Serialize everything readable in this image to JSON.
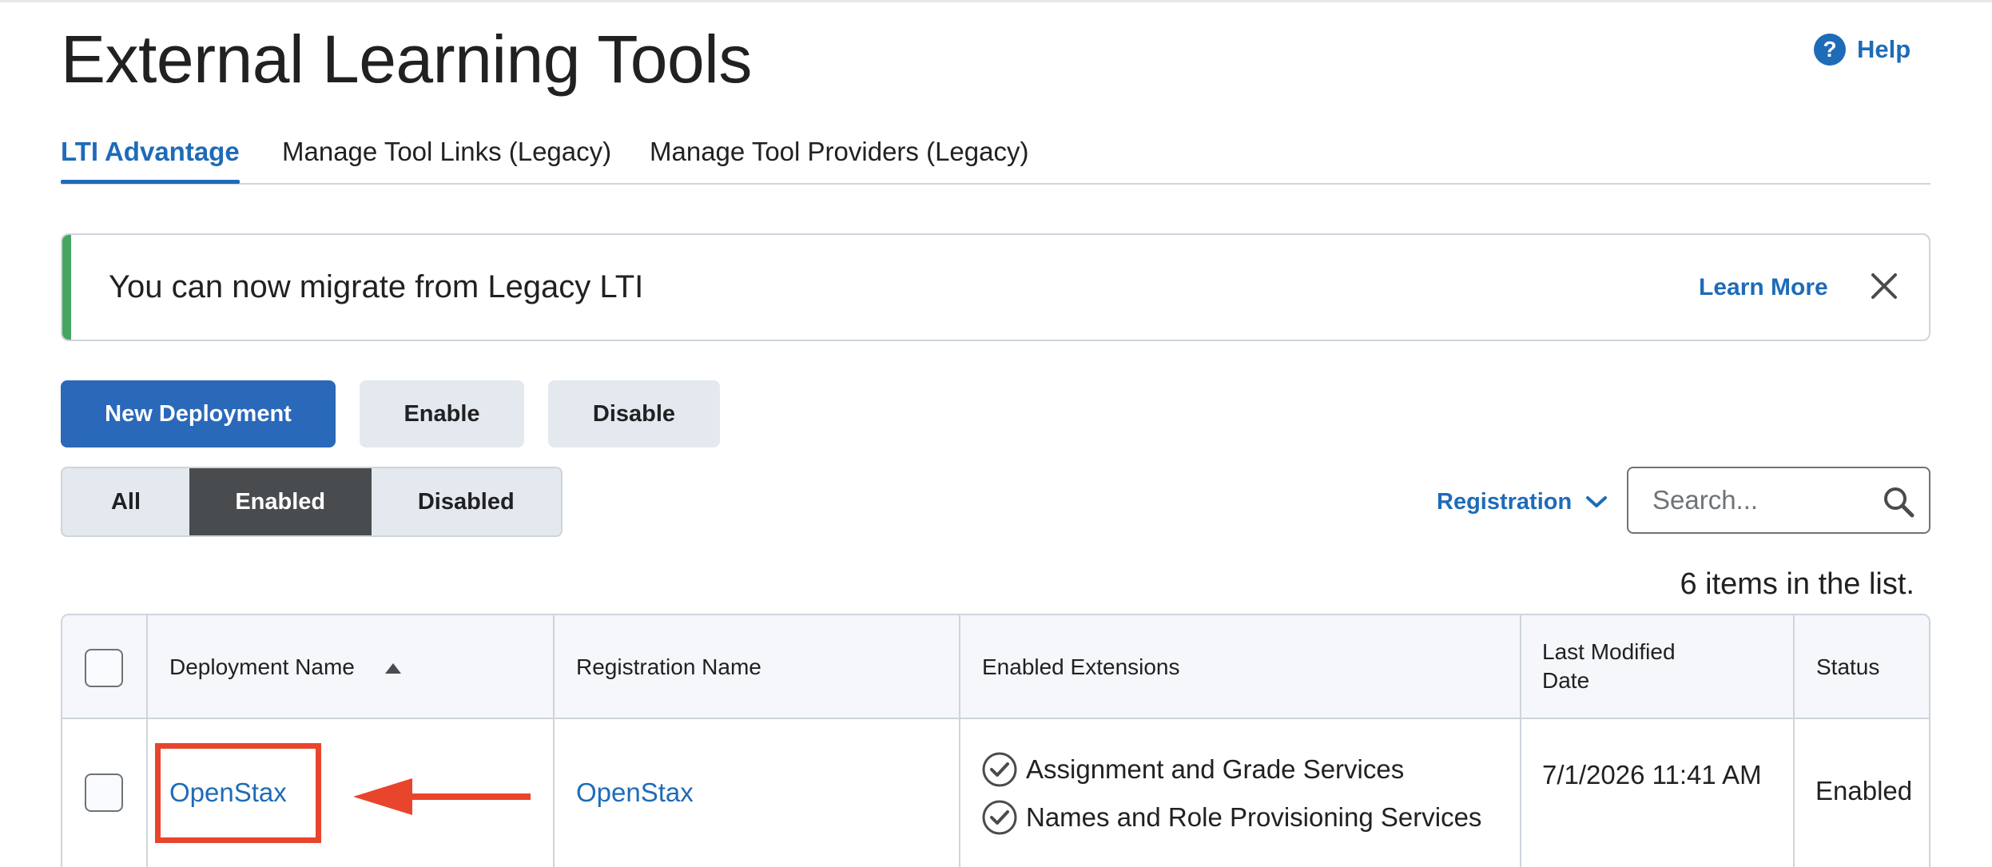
{
  "page": {
    "title": "External Learning Tools"
  },
  "help": {
    "label": "Help",
    "icon": "help-circle-icon"
  },
  "tabs": [
    {
      "label": "LTI Advantage",
      "active": true
    },
    {
      "label": "Manage Tool Links (Legacy)",
      "active": false
    },
    {
      "label": "Manage Tool Providers (Legacy)",
      "active": false
    }
  ],
  "alert": {
    "message": "You can now migrate from Legacy LTI",
    "link_label": "Learn More",
    "accent_color": "#46a661"
  },
  "toolbar": {
    "new_deployment_label": "New Deployment",
    "enable_label": "Enable",
    "disable_label": "Disable"
  },
  "filter": {
    "options": [
      "All",
      "Enabled",
      "Disabled"
    ],
    "selected": "Enabled"
  },
  "registration_dropdown": {
    "label": "Registration"
  },
  "search": {
    "placeholder": "Search...",
    "value": ""
  },
  "list_count": "6 items in the list.",
  "table": {
    "columns": [
      {
        "label": "Deployment Name",
        "sorted": "asc"
      },
      {
        "label": "Registration Name"
      },
      {
        "label": "Enabled Extensions"
      },
      {
        "label": "Last Modified Date"
      },
      {
        "label": "Status"
      }
    ],
    "rows": [
      {
        "deployment_name": "OpenStax",
        "registration_name": "OpenStax",
        "extensions": [
          "Assignment and Grade Services",
          "Names and Role Provisioning Services"
        ],
        "last_modified": "7/1/2026 11:41 AM",
        "status": "Enabled"
      }
    ]
  },
  "colors": {
    "primary": "#2a68b9",
    "link": "#1e6bb8",
    "annotation": "#e8452c"
  }
}
